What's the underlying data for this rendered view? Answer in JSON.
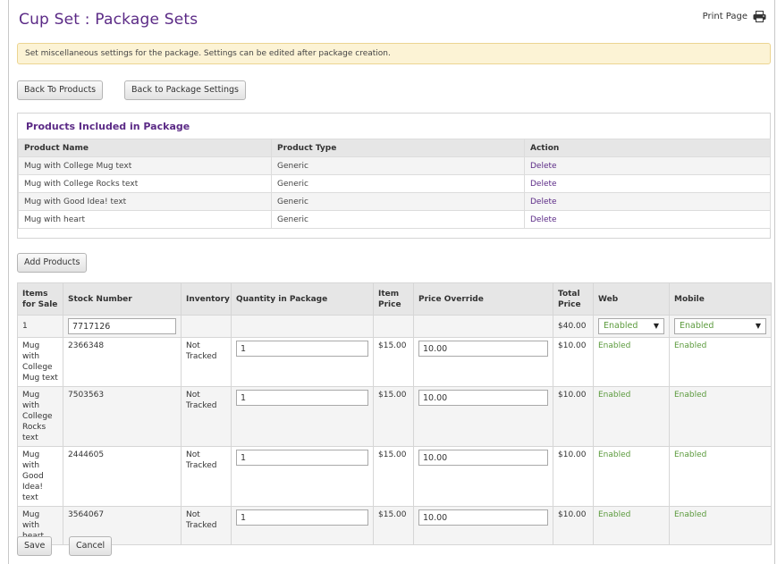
{
  "page": {
    "title": "Cup Set : Package Sets",
    "print_label": "Print Page"
  },
  "banner": {
    "text": "Set miscellaneous settings for the package. Settings can be edited after package creation."
  },
  "buttons": {
    "back_to_products": "Back To Products",
    "back_to_package_settings": "Back to Package Settings",
    "add_products": "Add Products",
    "save": "Save",
    "cancel": "Cancel"
  },
  "products_panel": {
    "title": "Products Included in Package",
    "headers": [
      "Product Name",
      "Product Type",
      "Action"
    ],
    "rows": [
      {
        "name": "Mug with College Mug text",
        "type": "Generic",
        "action": "Delete"
      },
      {
        "name": "Mug with College Rocks text",
        "type": "Generic",
        "action": "Delete"
      },
      {
        "name": "Mug with Good Idea! text",
        "type": "Generic",
        "action": "Delete"
      },
      {
        "name": "Mug with heart",
        "type": "Generic",
        "action": "Delete"
      }
    ]
  },
  "items_table": {
    "headers": [
      "Items for Sale",
      "Stock Number",
      "Inventory",
      "Quantity in Package",
      "Item Price",
      "Price Override",
      "Total Price",
      "Web",
      "Mobile"
    ],
    "base_row": {
      "items": "1",
      "stock_number": "7717126",
      "total_price": "$40.00",
      "web": "Enabled",
      "mobile": "Enabled"
    },
    "rows": [
      {
        "item": "Mug with College Mug text",
        "stock": "2366348",
        "inventory": "Not Tracked",
        "quantity": "1",
        "item_price": "$15.00",
        "price_override": "10.00",
        "total_price": "$10.00",
        "web": "Enabled",
        "mobile": "Enabled"
      },
      {
        "item": "Mug with College Rocks text",
        "stock": "7503563",
        "inventory": "Not Tracked",
        "quantity": "1",
        "item_price": "$15.00",
        "price_override": "10.00",
        "total_price": "$10.00",
        "web": "Enabled",
        "mobile": "Enabled"
      },
      {
        "item": "Mug with Good Idea! text",
        "stock": "2444605",
        "inventory": "Not Tracked",
        "quantity": "1",
        "item_price": "$15.00",
        "price_override": "10.00",
        "total_price": "$10.00",
        "web": "Enabled",
        "mobile": "Enabled"
      },
      {
        "item": "Mug with heart",
        "stock": "3564067",
        "inventory": "Not Tracked",
        "quantity": "1",
        "item_price": "$15.00",
        "price_override": "10.00",
        "total_price": "$10.00",
        "web": "Enabled",
        "mobile": "Enabled"
      }
    ]
  },
  "icons": {
    "print": "printer-icon",
    "dropdown": "chevron-down-icon"
  },
  "colors": {
    "title": "#5b2a86",
    "enabled": "#5b9a3c",
    "banner_bg": "#fcf3d5",
    "banner_border": "#ecd591"
  }
}
